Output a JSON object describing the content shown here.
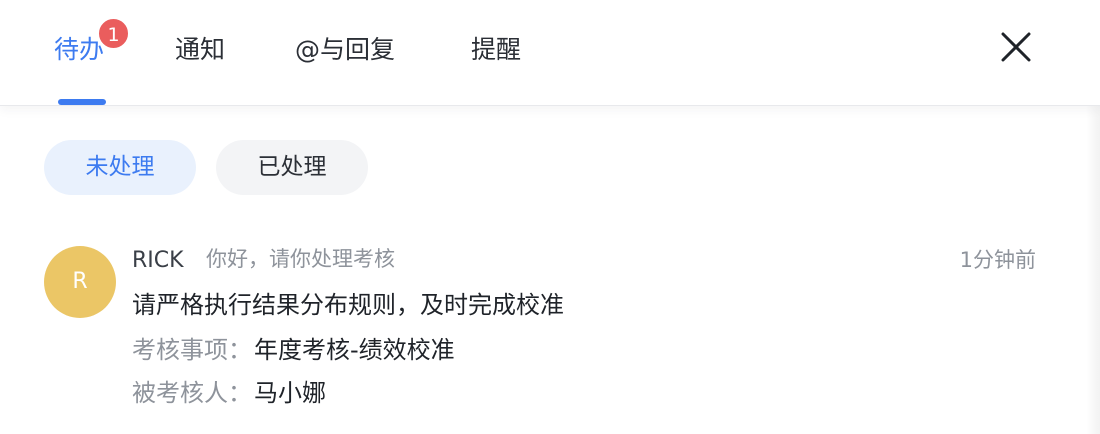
{
  "tabs": {
    "todo": "待办",
    "notice": "通知",
    "mention": "@与回复",
    "remind": "提醒",
    "todo_badge": "1"
  },
  "filters": {
    "pending": "未处理",
    "done": "已处理"
  },
  "message": {
    "avatar_initial": "R",
    "sender": "RICK",
    "greeting": "你好，请你处理考核",
    "time": "1分钟前",
    "title": "请严格执行结果分布规则，及时完成校准",
    "item_label": "考核事项：",
    "item_value": "年度考核-绩效校准",
    "person_label": "被考核人：",
    "person_value": "马小娜"
  },
  "colors": {
    "accent": "#3d7bf0",
    "badge": "#ea5d5d",
    "avatar": "#ebc666"
  },
  "icons": {
    "close": "close-icon"
  }
}
